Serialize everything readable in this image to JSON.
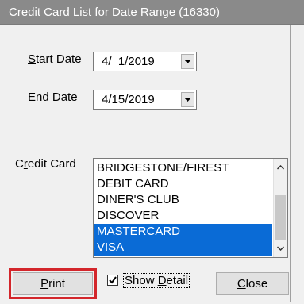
{
  "window": {
    "title": "Credit Card List for Date Range (16330)"
  },
  "form": {
    "start_date_label_first": "S",
    "start_date_label_rest": "tart Date",
    "start_date_value": "4/  1/2019",
    "end_date_label_first": "E",
    "end_date_label_rest": "nd Date",
    "end_date_value": "4/15/2019",
    "credit_card_label_pre": "C",
    "credit_card_label_u": "r",
    "credit_card_label_rest": "edit Card"
  },
  "credit_cards": {
    "items": [
      {
        "label": "BRIDGESTONE/FIREST",
        "selected": false
      },
      {
        "label": "DEBIT CARD",
        "selected": false
      },
      {
        "label": "DINER'S CLUB",
        "selected": false
      },
      {
        "label": "DISCOVER",
        "selected": false
      },
      {
        "label": "MASTERCARD",
        "selected": true
      },
      {
        "label": "VISA",
        "selected": true
      }
    ],
    "selected_color": "#0a6bd6"
  },
  "footer": {
    "print_u": "P",
    "print_rest": "rint",
    "show_detail_pre": "Show ",
    "show_detail_u": "D",
    "show_detail_rest": "etail",
    "show_detail_checked": true,
    "close_u": "C",
    "close_rest": "lose"
  },
  "colors": {
    "highlight_border": "#d3262b",
    "titlebar": "#8a8a8a"
  }
}
